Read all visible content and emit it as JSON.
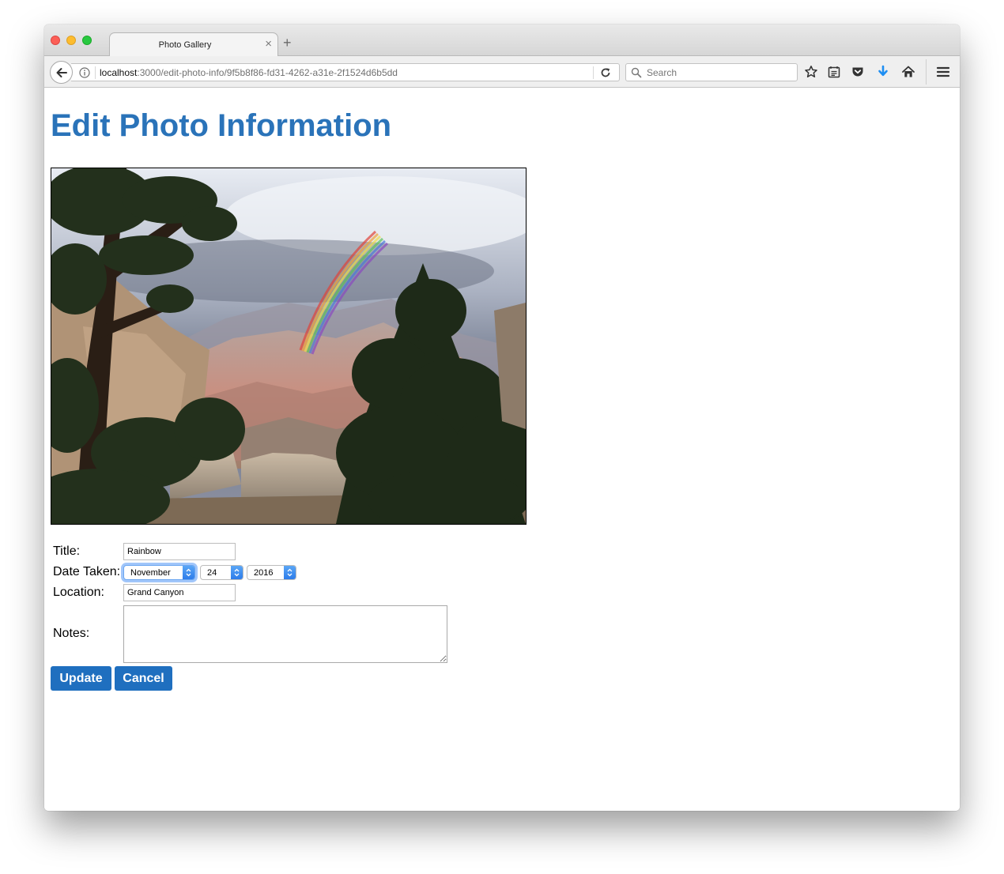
{
  "browser": {
    "tab_title": "Photo Gallery",
    "tab_close": "×",
    "new_tab": "+",
    "url_host": "localhost",
    "url_rest": ":3000/edit-photo-info/9f5b8f86-fd31-4262-a31e-2f1524d6b5dd",
    "search_placeholder": "Search",
    "accent_color": "#2a73b9"
  },
  "page": {
    "heading": "Edit Photo Information",
    "photo_alt": "rainbow over canyon with trees",
    "form": {
      "title_label": "Title:",
      "title_value": "Rainbow",
      "date_label": "Date Taken:",
      "month_value": "November",
      "day_value": "24",
      "year_value": "2016",
      "location_label": "Location:",
      "location_value": "Grand Canyon",
      "notes_label": "Notes:",
      "notes_value": ""
    },
    "buttons": {
      "update": "Update",
      "cancel": "Cancel",
      "color": "#1f6fbf"
    }
  }
}
